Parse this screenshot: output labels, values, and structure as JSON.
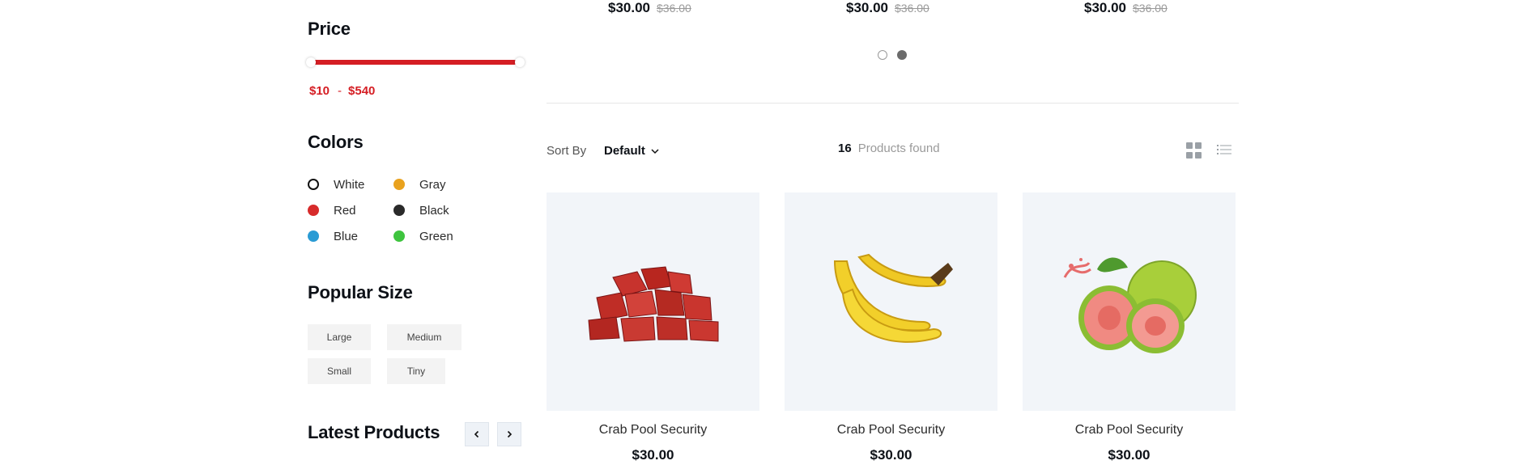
{
  "sidebar": {
    "price": {
      "title": "Price",
      "min_label": "$10",
      "separator": "-",
      "max_label": "$540",
      "accent_color": "#d51e24"
    },
    "colors": {
      "title": "Colors",
      "items": [
        {
          "label": "White",
          "color": "#ffffff"
        },
        {
          "label": "Gray",
          "color": "#e9a21e"
        },
        {
          "label": "Red",
          "color": "#d72b2b"
        },
        {
          "label": "Black",
          "color": "#2a2a2a"
        },
        {
          "label": "Blue",
          "color": "#2a9bd4"
        },
        {
          "label": "Green",
          "color": "#3ec43e"
        }
      ]
    },
    "sizes": {
      "title": "Popular Size",
      "items": [
        "Large",
        "Medium",
        "Small",
        "Tiny"
      ]
    },
    "latest": {
      "title": "Latest Products",
      "prev_icon": "chevron-left-icon",
      "next_icon": "chevron-right-icon"
    }
  },
  "carousel": {
    "prices": [
      {
        "price": "$30.00",
        "old_price": "$36.00"
      },
      {
        "price": "$30.00",
        "old_price": "$36.00"
      },
      {
        "price": "$30.00",
        "old_price": "$36.00"
      }
    ],
    "page_count": 2,
    "active_page": 2
  },
  "toolbar": {
    "sort_label": "Sort By",
    "sort_value": "Default",
    "found_count": "16",
    "found_text": "Products found",
    "grid_view_icon": "grid-view-icon",
    "list_view_icon": "list-view-icon"
  },
  "products": [
    {
      "name": "Crab Pool Security",
      "price": "$30.00",
      "image": "meat-cubes-image"
    },
    {
      "name": "Crab Pool Security",
      "price": "$30.00",
      "image": "bananas-image"
    },
    {
      "name": "Crab Pool Security",
      "price": "$30.00",
      "image": "guava-image"
    }
  ]
}
